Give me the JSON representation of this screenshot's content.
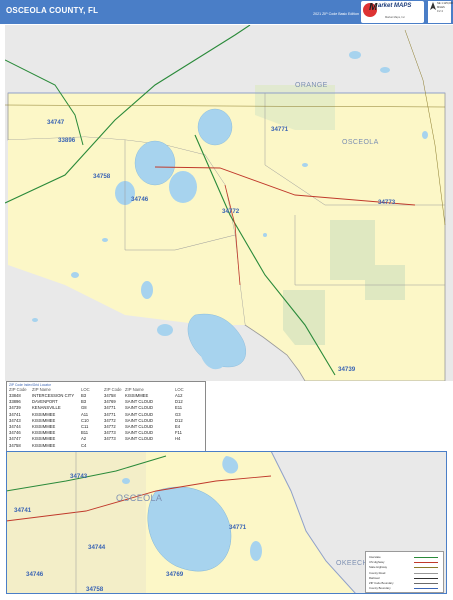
{
  "header": {
    "title": "OSCEOLA COUNTY, FL",
    "edition": "2021 ZIP Code Basic Edition"
  },
  "logo": {
    "text": "arket MAPS",
    "tagline": "Market Maps, Inc"
  },
  "scale": {
    "lines": [
      "NE 1:125,000",
      "MILES",
      "0 2 4"
    ]
  },
  "map": {
    "county_labels": [
      "ORANGE",
      "OSCEOLA"
    ],
    "zip_labels": [
      {
        "zip": "34747",
        "anchor": "west"
      },
      {
        "zip": "33896",
        "anchor": "west"
      },
      {
        "zip": "34771",
        "anchor": "north"
      },
      {
        "zip": "34758",
        "anchor": "center-west"
      },
      {
        "zip": "34746",
        "anchor": "center"
      },
      {
        "zip": "34772",
        "anchor": "center"
      },
      {
        "zip": "34773",
        "anchor": "east"
      },
      {
        "zip": "34739",
        "anchor": "south-east"
      }
    ]
  },
  "zip_table": {
    "title": "ZIP Code Index/Grid Locator",
    "headers": [
      "ZIP Code",
      "ZIP Name",
      "LOC",
      "ZIP Code",
      "ZIP Name",
      "LOC"
    ],
    "rows_left": [
      [
        "33848",
        "INTERCESSION CITY",
        "B3"
      ],
      [
        "33896",
        "DAVENPORT",
        "B3"
      ],
      [
        "34739",
        "KENANSVILLE",
        "G8"
      ],
      [
        "34741",
        "KISSIMMEE",
        "A11"
      ],
      [
        "34743",
        "KISSIMMEE",
        "C10"
      ],
      [
        "34744",
        "KISSIMMEE",
        "C11"
      ],
      [
        "34746",
        "KISSIMMEE",
        "B11"
      ],
      [
        "34747",
        "KISSIMMEE",
        "A2"
      ],
      [
        "34758",
        "KISSIMMEE",
        "C4"
      ]
    ],
    "rows_right": [
      [
        "34758",
        "KISSIMMEE",
        "A12"
      ],
      [
        "34769",
        "SAINT CLOUD",
        "D12"
      ],
      [
        "34771",
        "SAINT CLOUD",
        "E11"
      ],
      [
        "34771",
        "SAINT CLOUD",
        "G3"
      ],
      [
        "34772",
        "SAINT CLOUD",
        "D12"
      ],
      [
        "34772",
        "SAINT CLOUD",
        "E4"
      ],
      [
        "34773",
        "SAINT CLOUD",
        "F11"
      ],
      [
        "34773",
        "SAINT CLOUD",
        "H4"
      ]
    ]
  },
  "inset": {
    "county_label": "OSCEOLA",
    "bottom_county_label": "OKEECHOBEE",
    "zip_labels": [
      "34743",
      "34741",
      "34744",
      "34771",
      "34746",
      "34769",
      "34758"
    ]
  },
  "legend": {
    "items": [
      "Interstate",
      "US Highway",
      "State Highway",
      "County Road",
      "Railroad",
      "ZIP Code Boundary",
      "County Boundary"
    ],
    "colors": [
      "#2a8a3a",
      "#c0392b",
      "#8a7a2a",
      "#999999",
      "#333333",
      "#6a6a6a",
      "#3a64b4"
    ]
  },
  "colors": {
    "header": "#4a7ec7",
    "county_fill": "#fcf7c7",
    "outside_fill": "#e9e9e9",
    "water": "#a7d3ee",
    "interstate": "#2a8a3a",
    "us_highway": "#c0392b",
    "zip_label": "#3a64b4"
  }
}
